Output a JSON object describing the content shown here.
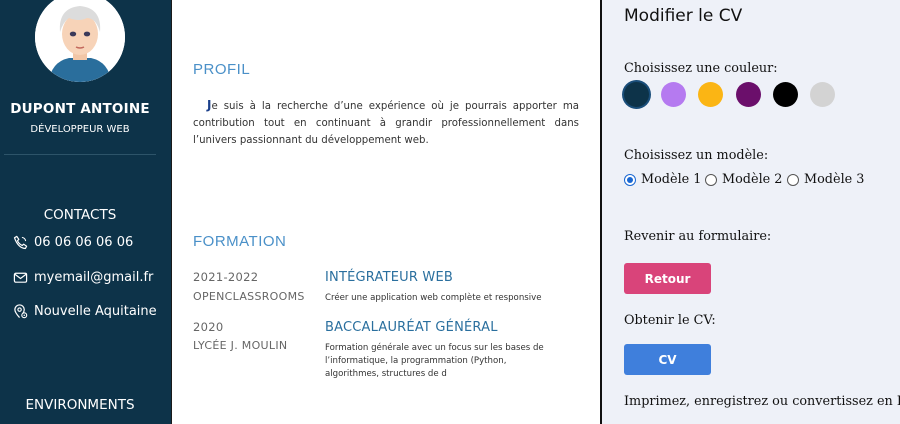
{
  "sidebar": {
    "name": "DUPONT ANTOINE",
    "job_title": "DÉVELOPPEUR WEB",
    "contacts_heading": "CONTACTS",
    "contacts": [
      {
        "icon": "phone-icon",
        "text": "06 06 06 06 06"
      },
      {
        "icon": "envelope-icon",
        "text": "myemail@gmail.fr"
      },
      {
        "icon": "location-icon",
        "text": "Nouvelle Aquitaine"
      }
    ],
    "environments_heading": "ENVIRONMENTS"
  },
  "cv": {
    "profil": {
      "title": "PROFIL",
      "dropcap": "J",
      "text": "e suis à la recherche d’une expérience où je pourrais apporter ma contribution tout en continuant à grandir professionnellement dans l’univers passionnant du développement web."
    },
    "formation": {
      "title": "FORMATION",
      "items": [
        {
          "date": "2021-2022",
          "school": "OPENCLASSROOMS",
          "title": "INTÉGRATEUR WEB",
          "description": "Créer une application web complète et responsive"
        },
        {
          "date": "2020",
          "school": "LYCÉE J. MOULIN",
          "title": "BACCALAURÉAT GÉNÉRAL",
          "description": "Formation générale avec un focus sur les bases de l’informatique, la programmation (Python, algorithmes, structures de d"
        }
      ]
    }
  },
  "panel": {
    "title": "Modifier le CV",
    "color_label": "Choisissez une couleur:",
    "colors": [
      "#0d3349",
      "#b57af0",
      "#fbb514",
      "#6b0f6b",
      "#000000",
      "#d3d3d3"
    ],
    "selected_color": "#0d3349",
    "model_label": "Choisissez un modèle:",
    "models": [
      "Modèle 1",
      "Modèle 2",
      "Modèle 3"
    ],
    "selected_model": "Modèle 1",
    "back_label": "Revenir au formulaire:",
    "back_button": "Retour",
    "back_button_color": "#d9447a",
    "get_label": "Obtenir le CV:",
    "cv_button": "CV",
    "cv_button_color": "#3f7fdc",
    "footer_text": "Imprimez, enregistrez ou convertissez en PDF, avec"
  }
}
